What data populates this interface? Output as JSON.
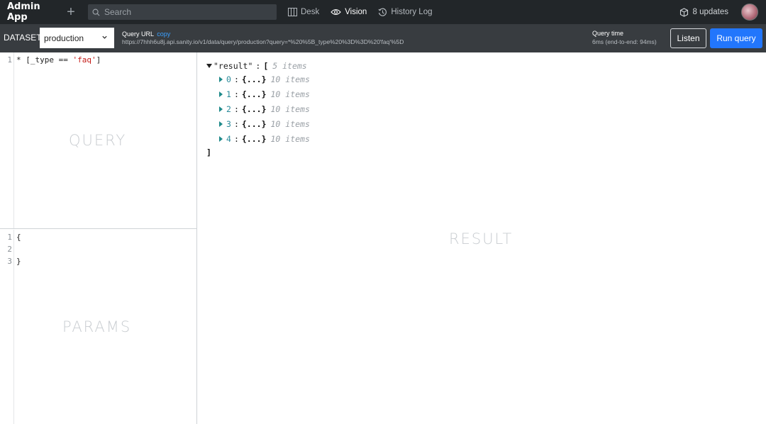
{
  "app": {
    "title": "Admin App"
  },
  "topbar": {
    "search_placeholder": "Search",
    "tools": [
      {
        "label": "Desk"
      },
      {
        "label": "Vision"
      },
      {
        "label": "History Log"
      }
    ],
    "updates_label": "8 updates"
  },
  "toolbar": {
    "dataset_label": "DATASET",
    "dataset_value": "production",
    "query_url_label": "Query URL",
    "copy_label": "copy",
    "query_url": "https://7hhh6u8j.api.sanity.io/v1/data/query/production?query=*%20%5B_type%20%3D%3D%20'faq'%5D",
    "query_time_label": "Query time",
    "query_time": "6ms (end-to-end: 94ms)",
    "listen_label": "Listen",
    "run_label": "Run query"
  },
  "query_pane": {
    "lines": [
      {
        "num": "1",
        "prefix": "* [_type == ",
        "string": "'faq'",
        "suffix": "]"
      }
    ],
    "watermark": "QUERY"
  },
  "params_pane": {
    "lines": [
      {
        "num": "1",
        "text": "{"
      },
      {
        "num": "2",
        "text": ""
      },
      {
        "num": "3",
        "text": "}"
      }
    ],
    "watermark": "PARAMS"
  },
  "result_pane": {
    "root_key": "\"result\"",
    "root_open": "[",
    "root_count": "5 items",
    "items": [
      {
        "index": "0",
        "value": "{...}",
        "count": "10 items"
      },
      {
        "index": "1",
        "value": "{...}",
        "count": "10 items"
      },
      {
        "index": "2",
        "value": "{...}",
        "count": "10 items"
      },
      {
        "index": "3",
        "value": "{...}",
        "count": "10 items"
      },
      {
        "index": "4",
        "value": "{...}",
        "count": "10 items"
      }
    ],
    "root_close": "]",
    "watermark": "RESULT"
  },
  "colors": {
    "accent": "#2276fc",
    "topbar": "#222629",
    "toolbar": "#383c40"
  }
}
